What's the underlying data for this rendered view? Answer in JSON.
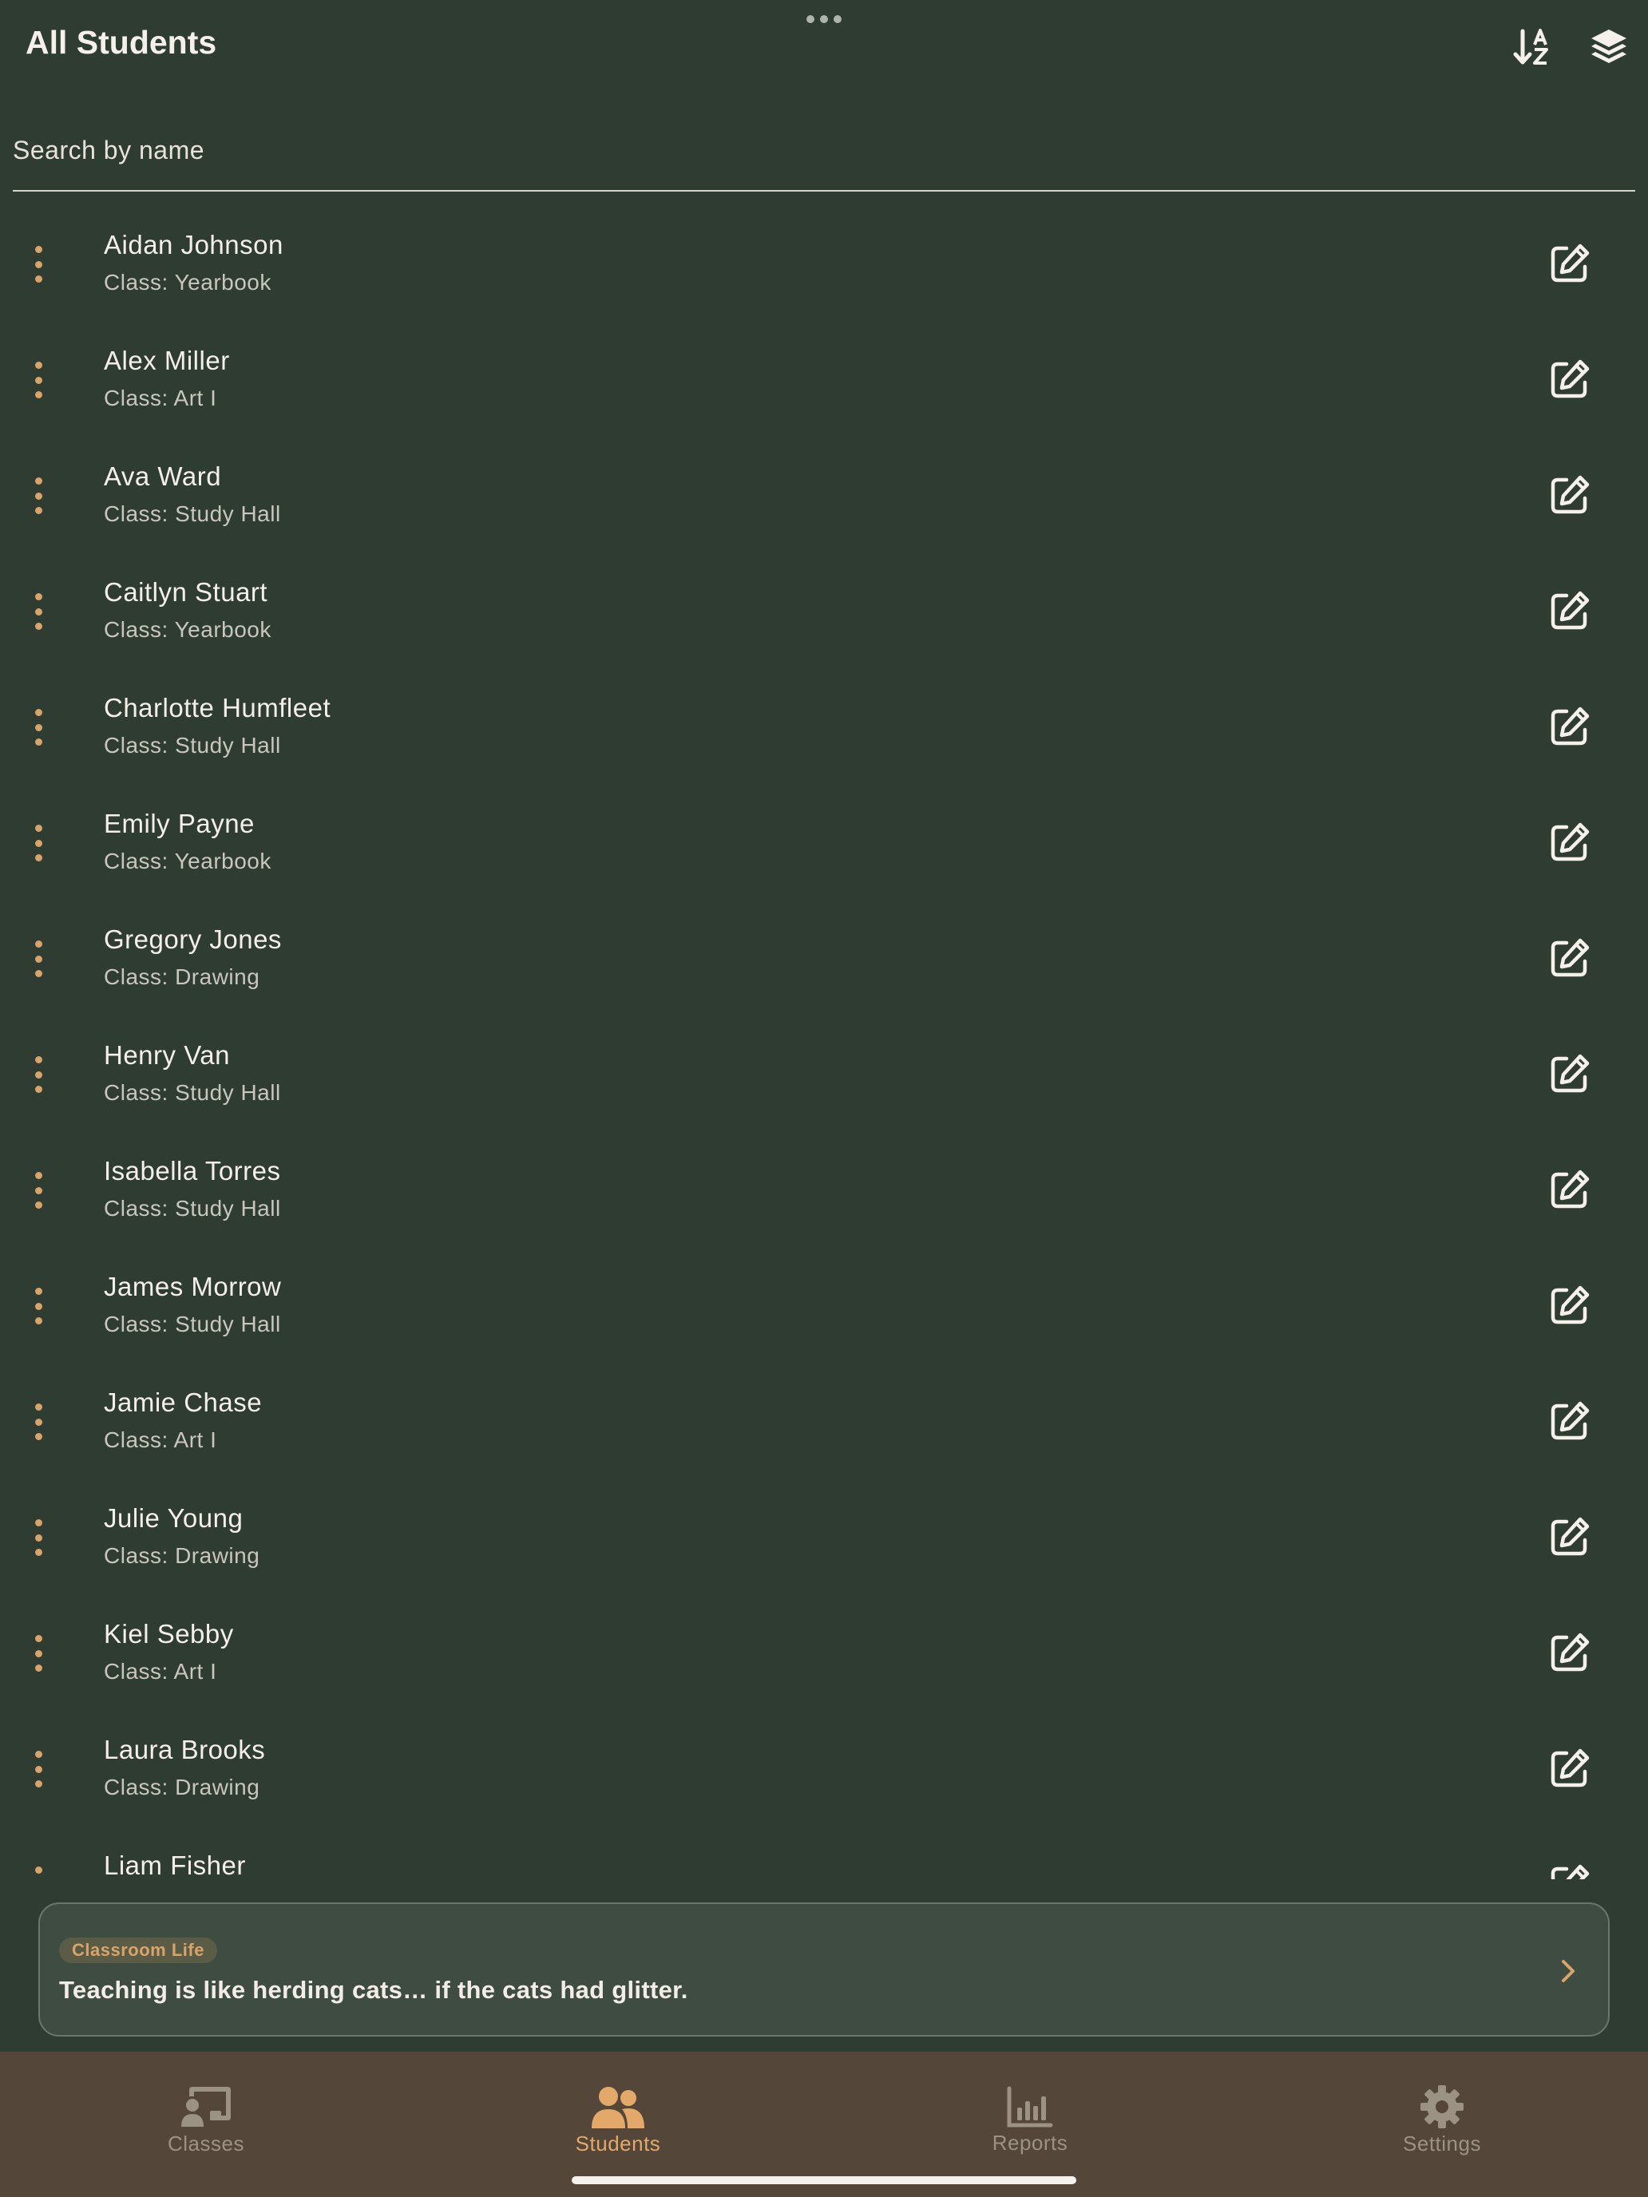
{
  "header": {
    "title": "All Students",
    "sort_icon": "sort-alpha-icon",
    "layers_icon": "layers-icon"
  },
  "search": {
    "placeholder": "Search by name",
    "value": ""
  },
  "students": [
    {
      "name": "Aidan Johnson",
      "class": "Class: Yearbook"
    },
    {
      "name": "Alex Miller",
      "class": "Class: Art I"
    },
    {
      "name": "Ava Ward",
      "class": "Class: Study Hall"
    },
    {
      "name": "Caitlyn Stuart",
      "class": "Class: Yearbook"
    },
    {
      "name": "Charlotte Humfleet",
      "class": "Class: Study Hall"
    },
    {
      "name": "Emily Payne",
      "class": "Class: Yearbook"
    },
    {
      "name": "Gregory Jones",
      "class": "Class: Drawing"
    },
    {
      "name": "Henry Van",
      "class": "Class: Study Hall"
    },
    {
      "name": "Isabella Torres",
      "class": "Class: Study Hall"
    },
    {
      "name": "James Morrow",
      "class": "Class: Study Hall"
    },
    {
      "name": "Jamie Chase",
      "class": "Class: Art I"
    },
    {
      "name": "Julie Young",
      "class": "Class: Drawing"
    },
    {
      "name": "Kiel Sebby",
      "class": "Class: Art I"
    },
    {
      "name": "Laura Brooks",
      "class": "Class: Drawing"
    },
    {
      "name": "Liam Fisher",
      "class": ""
    }
  ],
  "banner": {
    "tag": "Classroom Life",
    "message": "Teaching is like herding cats… if the cats had glitter."
  },
  "tabs": [
    {
      "label": "Classes",
      "icon": "classroom-icon",
      "active": false
    },
    {
      "label": "Students",
      "icon": "students-icon",
      "active": true
    },
    {
      "label": "Reports",
      "icon": "bar-chart-icon",
      "active": false
    },
    {
      "label": "Settings",
      "icon": "gear-icon",
      "active": false
    }
  ],
  "colors": {
    "background": "#2e3c31",
    "accent": "#d9a46a",
    "tabbar": "#54473a",
    "banner": "#3f4c42"
  }
}
